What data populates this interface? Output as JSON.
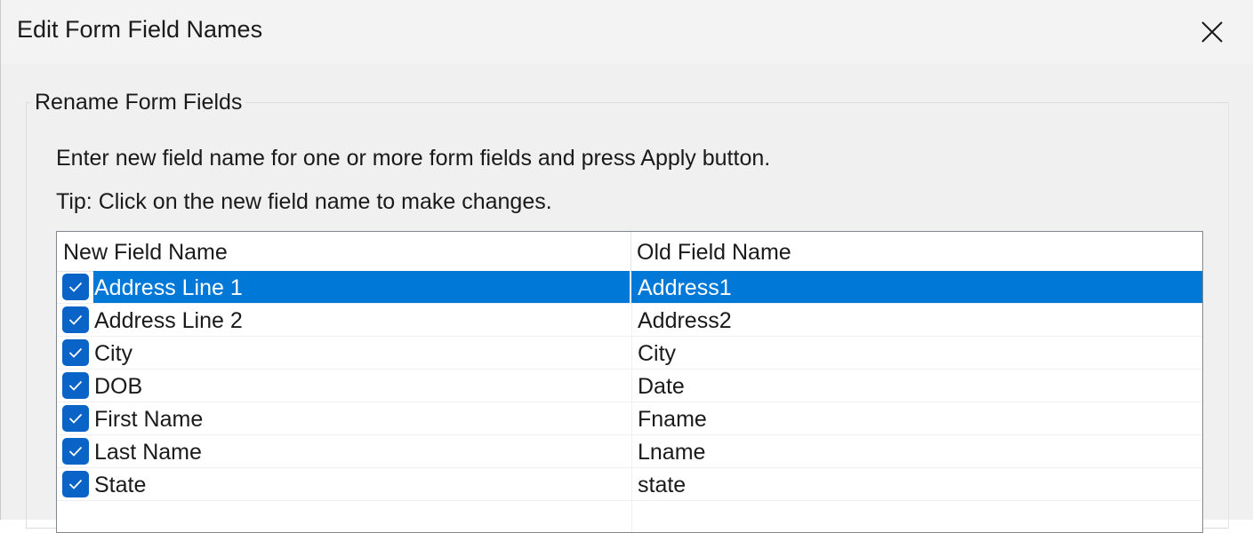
{
  "window": {
    "title": "Edit Form Field Names",
    "close_icon": "close-icon"
  },
  "group": {
    "title": "Rename Form Fields",
    "instruction": "Enter new field name for one or more form fields and press Apply button.",
    "tip": "Tip: Click on the new field name to make changes."
  },
  "list": {
    "columns": [
      "New Field Name",
      "Old Field Name"
    ],
    "rows": [
      {
        "checked": true,
        "new_name": "Address Line 1",
        "old_name": "Address1",
        "selected": true
      },
      {
        "checked": true,
        "new_name": "Address Line 2",
        "old_name": "Address2",
        "selected": false
      },
      {
        "checked": true,
        "new_name": "City",
        "old_name": "City",
        "selected": false
      },
      {
        "checked": true,
        "new_name": "DOB",
        "old_name": "Date",
        "selected": false
      },
      {
        "checked": true,
        "new_name": "First Name",
        "old_name": "Fname",
        "selected": false
      },
      {
        "checked": true,
        "new_name": "Last Name",
        "old_name": "Lname",
        "selected": false
      },
      {
        "checked": true,
        "new_name": "State",
        "old_name": "state",
        "selected": false
      }
    ]
  },
  "colors": {
    "selection": "#0078d7",
    "checkbox": "#0a63c7",
    "dialog_bg": "#f0f0f0"
  }
}
